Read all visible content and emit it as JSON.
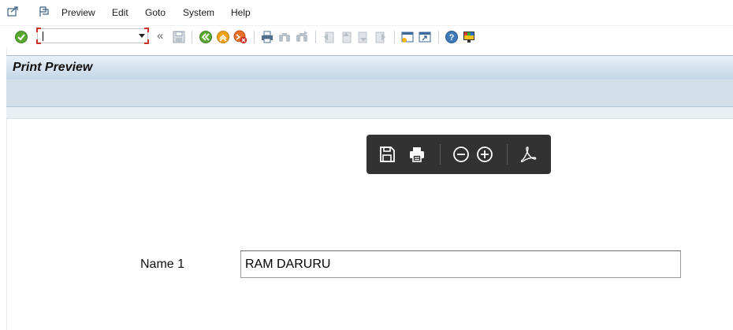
{
  "menubar": {
    "items": [
      {
        "accel": "",
        "label": "Preview",
        "text": "Preview"
      },
      {
        "label": "Edit"
      },
      {
        "label": "Goto"
      },
      {
        "label": "System"
      },
      {
        "label": "Help"
      }
    ]
  },
  "toolbar": {
    "command_field": {
      "value": "",
      "placeholder": ""
    },
    "back_chevron": "«"
  },
  "page": {
    "title": "Print Preview"
  },
  "pdf_toolbar": {
    "icons": [
      "save-icon",
      "print-icon",
      "zoom-out-icon",
      "zoom-in-icon",
      "acrobat-icon"
    ]
  },
  "form": {
    "name_label": "Name 1",
    "name_value": "RAM DARURU"
  },
  "colors": {
    "title_gradient_top": "#e8f0f6",
    "title_gradient_bottom": "#c3d6e6",
    "app_toolbar": "#d2dfe9",
    "pdf_toolbar_bg": "#323232",
    "command_field_corner": "#d0302a"
  }
}
